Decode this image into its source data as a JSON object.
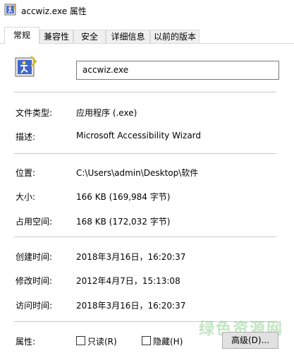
{
  "window": {
    "title": "accwiz.exe 属性",
    "icon": "accessibility-wizard-icon"
  },
  "tabs": [
    {
      "label": "常规",
      "active": true
    },
    {
      "label": "兼容性",
      "active": false
    },
    {
      "label": "安全",
      "active": false
    },
    {
      "label": "详细信息",
      "active": false
    },
    {
      "label": "以前的版本",
      "active": false
    }
  ],
  "general": {
    "file_name": "accwiz.exe",
    "file_type_label": "文件类型:",
    "file_type_value": "应用程序 (.exe)",
    "description_label": "描述:",
    "description_value": "Microsoft Accessibility Wizard",
    "location_label": "位置:",
    "location_value": "C:\\Users\\admin\\Desktop\\软件",
    "size_label": "大小:",
    "size_value": "166 KB (169,984 字节)",
    "size_on_disk_label": "占用空间:",
    "size_on_disk_value": "168 KB (172,032 字节)",
    "created_label": "创建时间:",
    "created_value": "2018年3月16日，16:20:37",
    "modified_label": "修改时间:",
    "modified_value": "2012年4月7日，15:13:08",
    "accessed_label": "访问时间:",
    "accessed_value": "2018年3月16日，16:20:37",
    "attributes_label": "属性:",
    "readonly_label": "只读(R)",
    "readonly_checked": false,
    "hidden_label": "隐藏(H)",
    "hidden_checked": false,
    "advanced_button": "高级(D)..."
  },
  "watermark": "绿色资源网"
}
